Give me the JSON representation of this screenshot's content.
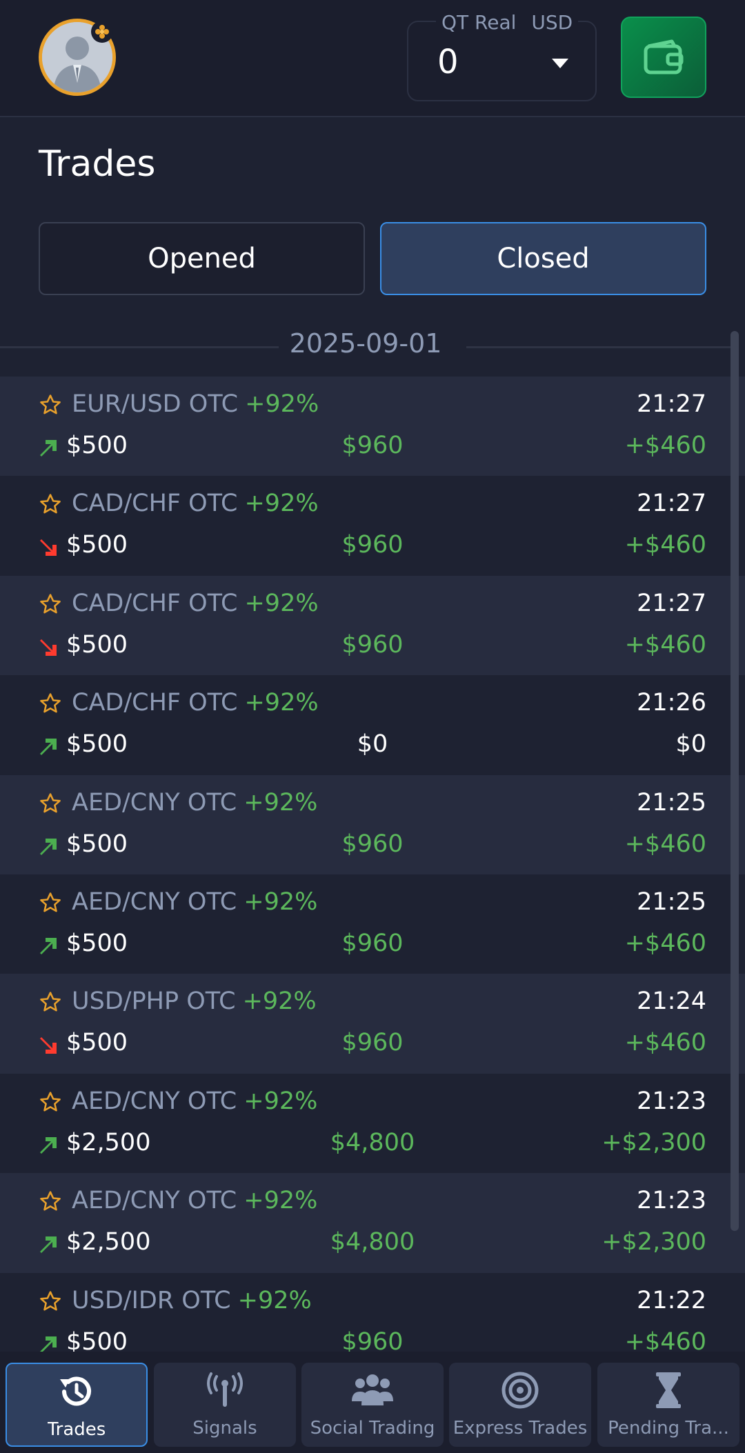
{
  "header": {
    "account_type": "QT Real",
    "currency": "USD",
    "balance": "0"
  },
  "page": {
    "title": "Trades"
  },
  "tabs": {
    "opened": "Opened",
    "closed": "Closed",
    "active": "closed"
  },
  "date_group": "2025-09-01",
  "colors": {
    "profit_green": "#5cb85c",
    "up_arrow": "#4caf50",
    "down_arrow": "#ff3b2f",
    "star": "#e9a12c",
    "accent_blue": "#3a8ee6"
  },
  "trades": [
    {
      "pair": "EUR/USD OTC",
      "pct": "+92%",
      "time": "21:27",
      "direction": "up",
      "amount": "$500",
      "payout": "$960",
      "profit": "+$460"
    },
    {
      "pair": "CAD/CHF OTC",
      "pct": "+92%",
      "time": "21:27",
      "direction": "down",
      "amount": "$500",
      "payout": "$960",
      "profit": "+$460"
    },
    {
      "pair": "CAD/CHF OTC",
      "pct": "+92%",
      "time": "21:27",
      "direction": "down",
      "amount": "$500",
      "payout": "$960",
      "profit": "+$460"
    },
    {
      "pair": "CAD/CHF OTC",
      "pct": "+92%",
      "time": "21:26",
      "direction": "up",
      "amount": "$500",
      "payout": "$0",
      "profit": "$0"
    },
    {
      "pair": "AED/CNY OTC",
      "pct": "+92%",
      "time": "21:25",
      "direction": "up",
      "amount": "$500",
      "payout": "$960",
      "profit": "+$460"
    },
    {
      "pair": "AED/CNY OTC",
      "pct": "+92%",
      "time": "21:25",
      "direction": "up",
      "amount": "$500",
      "payout": "$960",
      "profit": "+$460"
    },
    {
      "pair": "USD/PHP OTC",
      "pct": "+92%",
      "time": "21:24",
      "direction": "down",
      "amount": "$500",
      "payout": "$960",
      "profit": "+$460"
    },
    {
      "pair": "AED/CNY OTC",
      "pct": "+92%",
      "time": "21:23",
      "direction": "up",
      "amount": "$2,500",
      "payout": "$4,800",
      "profit": "+$2,300"
    },
    {
      "pair": "AED/CNY OTC",
      "pct": "+92%",
      "time": "21:23",
      "direction": "up",
      "amount": "$2,500",
      "payout": "$4,800",
      "profit": "+$2,300"
    },
    {
      "pair": "USD/IDR OTC",
      "pct": "+92%",
      "time": "21:22",
      "direction": "up",
      "amount": "$500",
      "payout": "$960",
      "profit": "+$460"
    }
  ],
  "bottom_nav": [
    {
      "label": "Trades",
      "icon": "history-icon",
      "active": true
    },
    {
      "label": "Signals",
      "icon": "antenna-icon",
      "active": false
    },
    {
      "label": "Social Trading",
      "icon": "users-icon",
      "active": false
    },
    {
      "label": "Express Trades",
      "icon": "target-icon",
      "active": false
    },
    {
      "label": "Pending Tra...",
      "icon": "hourglass-icon",
      "active": false
    }
  ]
}
